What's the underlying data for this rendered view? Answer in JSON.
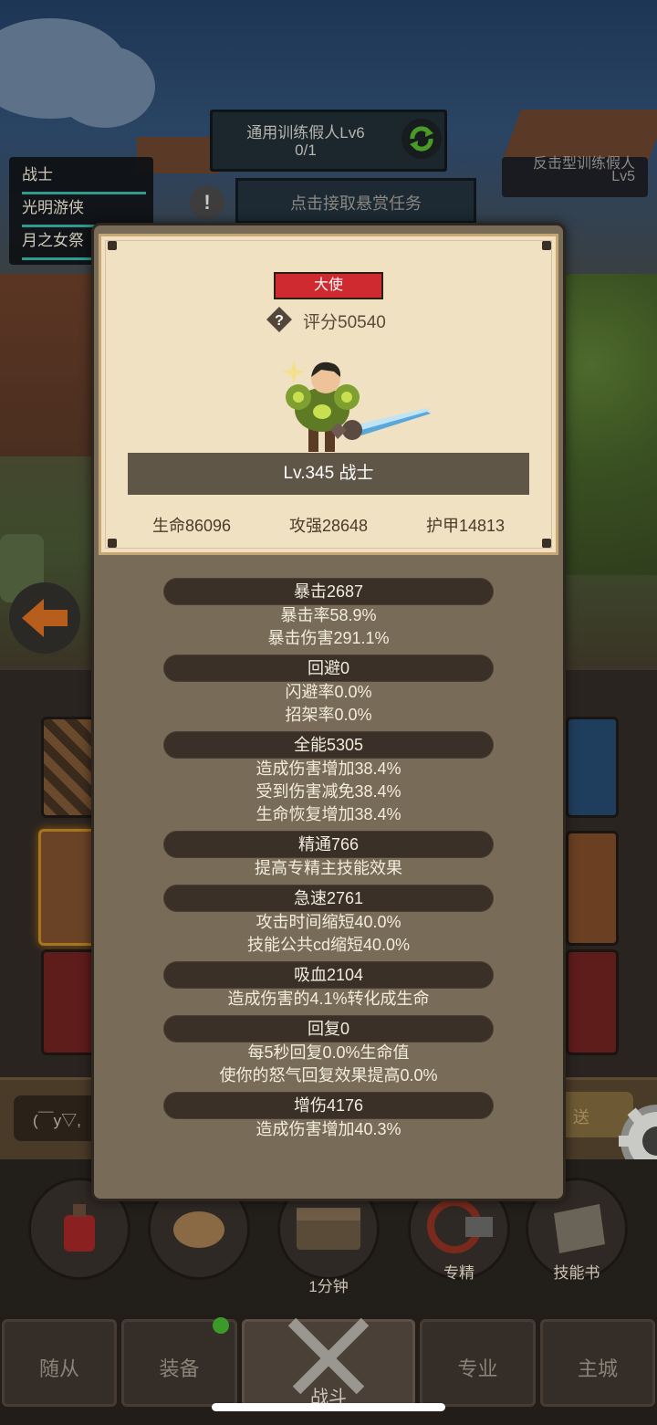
{
  "colors": {
    "accent_red": "#cf2a30",
    "parchment": "#efe1c2",
    "modal": "#786b57",
    "pill": "#3a3028",
    "teal": "#2f9a8f",
    "text_light": "#f3ecdd",
    "notification_green": "#3c9a2a"
  },
  "party": {
    "items": [
      "战士",
      "光明游侠",
      "月之女祭"
    ]
  },
  "quest": {
    "title": "通用训练假人Lv6",
    "progress": "0/1",
    "icon": "refresh-icon"
  },
  "enemy": {
    "name": "反击型训练假人",
    "level": "Lv5"
  },
  "bounty": {
    "alert": "!",
    "label": "点击接取悬赏任务"
  },
  "profile": {
    "badge": "大使",
    "score_icon": "question-diamond-icon",
    "score": "评分50540",
    "level_class": "Lv.345 战士",
    "stats": [
      "生命86096",
      "攻强28648",
      "护甲14813"
    ]
  },
  "attributes": [
    {
      "header": "暴击2687",
      "lines": [
        "暴击率58.9%",
        "暴击伤害291.1%"
      ]
    },
    {
      "header": "回避0",
      "lines": [
        "闪避率0.0%",
        "招架率0.0%"
      ]
    },
    {
      "header": "全能5305",
      "lines": [
        "造成伤害增加38.4%",
        "受到伤害减免38.4%",
        "生命恢复增加38.4%"
      ]
    },
    {
      "header": "精通766",
      "lines": [
        "提高专精主技能效果"
      ]
    },
    {
      "header": "急速2761",
      "lines": [
        "攻击时间缩短40.0%",
        "技能公共cd缩短40.0%"
      ]
    },
    {
      "header": "吸血2104",
      "lines": [
        "造成伤害的4.1%转化成生命"
      ]
    },
    {
      "header": "回复0",
      "lines": [
        "每5秒回复0.0%生命值",
        "使你的怒气回复效果提高0.0%"
      ]
    },
    {
      "header": "增伤4176",
      "lines": [
        "造成伤害增加40.3%"
      ]
    }
  ],
  "hud": {
    "chat_text": "(￣y▽,",
    "send_label": "送",
    "timer": "1分钟",
    "spec": "专精",
    "skill_book": "技能书"
  },
  "nav": {
    "tabs": [
      "随从",
      "装备",
      "战斗",
      "专业",
      "主城"
    ],
    "active": "战斗"
  }
}
